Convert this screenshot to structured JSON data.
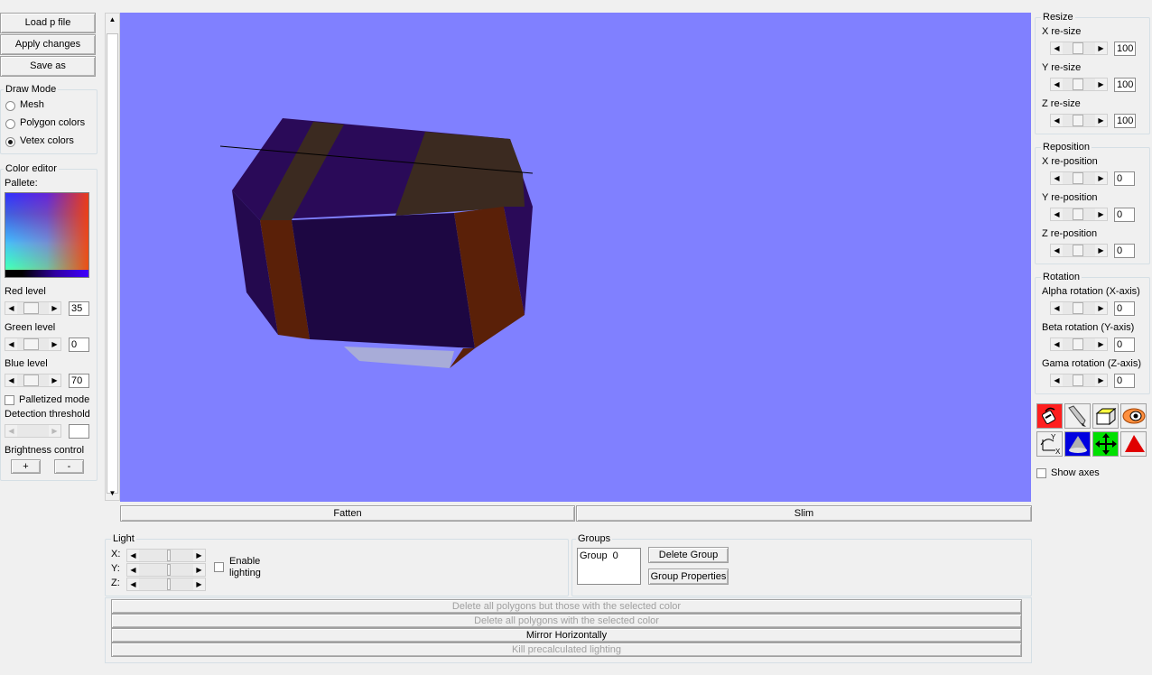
{
  "top_buttons": {
    "load": "Load p file",
    "apply": "Apply changes",
    "save_as": "Save as"
  },
  "draw_mode": {
    "title": "Draw Mode",
    "options": [
      "Mesh",
      "Polygon colors",
      "Vetex colors"
    ],
    "selected_index": 2
  },
  "color_editor": {
    "title": "Color editor",
    "pallete_label": "Pallete:",
    "red_label": "Red level",
    "red_value": "35",
    "green_label": "Green level",
    "green_value": "0",
    "blue_label": "Blue level",
    "blue_value": "70",
    "palletized_label": "Palletized mode",
    "palletized_checked": false,
    "threshold_label": "Detection threshold",
    "threshold_value": "",
    "brightness_label": "Brightness control",
    "plus": "+",
    "minus": "-"
  },
  "viewport": {
    "background": "#8080ff"
  },
  "bottom_bar": {
    "fatten": "Fatten",
    "slim": "Slim"
  },
  "light": {
    "title": "Light",
    "x": "X:",
    "y": "Y:",
    "z": "Z:",
    "enable_label_1": "Enable",
    "enable_label_2": "lighting",
    "enabled": false
  },
  "groups": {
    "title": "Groups",
    "items": [
      "Group  0"
    ],
    "delete": "Delete Group",
    "properties": "Group Properties"
  },
  "actions": {
    "delete_but_selected": "Delete all polygons but those with the selected color",
    "delete_selected": "Delete all polygons with the selected color",
    "mirror": "Mirror Horizontally",
    "kill_lighting": "Kill precalculated lighting"
  },
  "resize": {
    "title": "Resize",
    "x_label": "X re-size",
    "x_value": "100",
    "y_label": "Y re-size",
    "y_value": "100",
    "z_label": "Z re-size",
    "z_value": "100"
  },
  "reposition": {
    "title": "Reposition",
    "x_label": "X re-position",
    "x_value": "0",
    "y_label": "Y re-position",
    "y_value": "0",
    "z_label": "Z re-position",
    "z_value": "0"
  },
  "rotation": {
    "title": "Rotation",
    "alpha_label": "Alpha rotation (X-axis)",
    "alpha_value": "0",
    "beta_label": "Beta rotation (Y-axis)",
    "beta_value": "0",
    "gama_label": "Gama rotation (Z-axis)",
    "gama_value": "0"
  },
  "tools": {
    "icons": [
      "paint-bucket-icon",
      "eyedropper-icon",
      "cube-icon",
      "eye-icon",
      "axes-icon",
      "cone-icon",
      "move-arrows-icon",
      "triangle-icon"
    ],
    "show_axes_label": "Show axes",
    "show_axes_checked": false
  },
  "scroll_arrows": {
    "left": "◀",
    "right": "▶",
    "up": "▲",
    "down": "▼"
  }
}
